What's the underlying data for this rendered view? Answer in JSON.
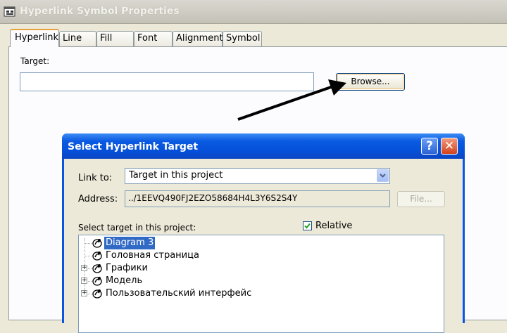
{
  "window": {
    "title": "Hyperlink Symbol Properties",
    "icon": "properties-window-icon"
  },
  "tabs": [
    {
      "label": "Hyperlink",
      "active": true
    },
    {
      "label": "Line",
      "active": false
    },
    {
      "label": "Fill",
      "active": false
    },
    {
      "label": "Font",
      "active": false
    },
    {
      "label": "Alignment",
      "active": false
    },
    {
      "label": "Symbol",
      "active": false
    }
  ],
  "hyperlink_tab": {
    "target_label": "Target:",
    "target_value": "",
    "browse_label": "Browse..."
  },
  "dialog": {
    "title": "Select Hyperlink Target",
    "help_glyph": "?",
    "close_glyph": "✕",
    "link_to_label": "Link to:",
    "link_to_value": "Target in this project",
    "address_label": "Address:",
    "address_value": "../1EEVQ490FJ2EZO58684H4L3Y6S2S4Y",
    "file_button": "File...",
    "select_target_label": "Select target in this project:",
    "relative_label": "Relative",
    "relative_checked": true,
    "tree": [
      {
        "label": "Diagram 3",
        "selected": true,
        "expandable": false
      },
      {
        "label": "Головная страница",
        "selected": false,
        "expandable": false
      },
      {
        "label": "Графики",
        "selected": false,
        "expandable": true
      },
      {
        "label": "Модель",
        "selected": false,
        "expandable": true
      },
      {
        "label": "Пользовательский интерфейс",
        "selected": false,
        "expandable": true
      }
    ]
  },
  "colors": {
    "xp_blue": "#0a56e0",
    "selection": "#316ac5",
    "tab_highlight": "#e7a23c",
    "close_red": "#d4421c"
  }
}
